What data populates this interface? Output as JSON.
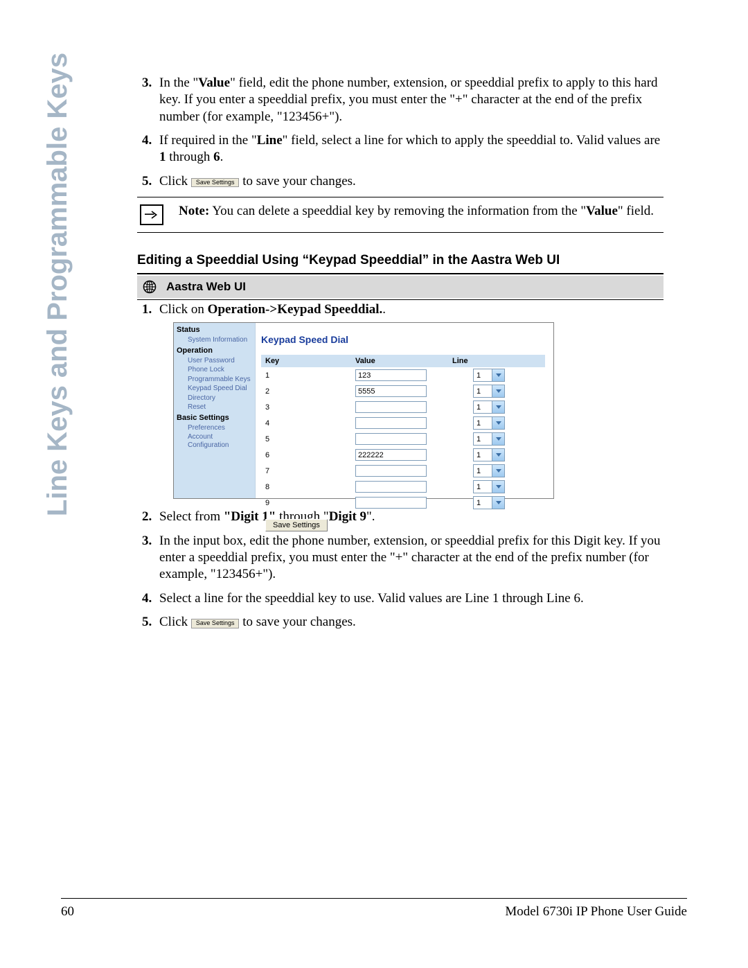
{
  "side_tab": "Line Keys and Programmable Keys",
  "top_steps_start": 3,
  "top_steps": [
    {
      "pre": "In the \"",
      "boldA": "Value",
      "mid": "\" field, edit the phone number, extension, or speeddial prefix to apply to this hard key. If you enter a speeddial prefix, you must enter the \"+\" character at the end of the prefix number (for example, \"123456+\")."
    },
    {
      "pre": "If required in the \"",
      "boldA": "Line",
      "mid": "\" field, select a line for which to apply the speeddial to. Valid values are ",
      "boldB": "1",
      "mid2": " through ",
      "boldC": "6",
      "tail": "."
    },
    {
      "pre": "Click ",
      "button": "Save Settings",
      "tail": " to save your changes."
    }
  ],
  "note": {
    "bold": "Note:",
    "text_a": "  You can delete a speeddial key by removing the information from the \"",
    "bold2": "Value",
    "text_b": "\" field."
  },
  "section_heading": "Editing a Speeddial Using “Keypad Speeddial” in the Aastra Web UI",
  "panel_title": "Aastra Web UI",
  "bottom_steps_start": 1,
  "bottom_steps": [
    {
      "pre": "Click on ",
      "boldA": "Operation->Keypad Speeddial.",
      "tail": ".",
      "has_ui": true
    },
    {
      "pre": "Select from ",
      "boldA": "\"Digit 1\"",
      "mid": " through \"",
      "boldB": "Digit 9",
      "tail": "\"."
    },
    {
      "plain": "In the input box, edit the phone number, extension, or speeddial prefix for this Digit key. If you enter a speeddial prefix, you must enter the \"+\" character at the end of the prefix number (for example, \"123456+\")."
    },
    {
      "plain": "Select a line for the speeddial key to use. Valid values are Line 1 through Line 6."
    },
    {
      "pre": "Click ",
      "button": "Save Settings",
      "tail": " to save your changes."
    }
  ],
  "webui": {
    "sidebar": {
      "status": "Status",
      "status_items": [
        "System Information"
      ],
      "operation": "Operation",
      "operation_items": [
        "User Password",
        "Phone Lock",
        "Programmable Keys",
        "Keypad Speed Dial",
        "Directory",
        "Reset"
      ],
      "basic": "Basic Settings",
      "basic_items": [
        "Preferences",
        "Account Configuration"
      ]
    },
    "title": "Keypad Speed Dial",
    "headers": {
      "key": "Key",
      "value": "Value",
      "line": "Line"
    },
    "rows": [
      {
        "key": "1",
        "value": "123",
        "line": "1"
      },
      {
        "key": "2",
        "value": "5555",
        "line": "1"
      },
      {
        "key": "3",
        "value": "",
        "line": "1"
      },
      {
        "key": "4",
        "value": "",
        "line": "1"
      },
      {
        "key": "5",
        "value": "",
        "line": "1"
      },
      {
        "key": "6",
        "value": "222222",
        "line": "1"
      },
      {
        "key": "7",
        "value": "",
        "line": "1"
      },
      {
        "key": "8",
        "value": "",
        "line": "1"
      },
      {
        "key": "9",
        "value": "",
        "line": "1"
      }
    ],
    "save_label": "Save Settings"
  },
  "footer": {
    "page": "60",
    "title": "Model 6730i IP Phone User Guide"
  }
}
